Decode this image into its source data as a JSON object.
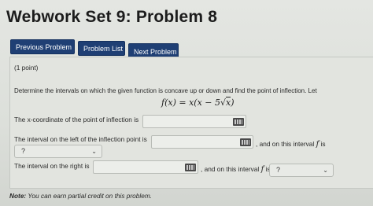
{
  "header": {
    "title": "Webwork Set 9: Problem 8"
  },
  "nav": {
    "previous_label": "Previous Problem",
    "list_label": "Problem List",
    "next_label": "Next Problem"
  },
  "problem": {
    "points": "(1 point)",
    "prompt": "Determine the intervals on which the given function is concave up or down and find the point of inflection. Let",
    "formula": {
      "lhs": "f(x) = x(x − 5",
      "radicand": "x",
      "close": ")"
    },
    "q1_label": "The x-coordinate of the point of inflection is",
    "q2_label": "The interval on the left of the inflection point is",
    "q2_suffix_before": ", and on this interval",
    "q2_suffix_var": "f",
    "q2_suffix_after": "is",
    "q2_select_value": "?",
    "q3_label": "The interval on the right is",
    "q3_suffix_before": ", and on this interval",
    "q3_suffix_var": "f",
    "q3_suffix_after": "is",
    "q3_select_value": "?"
  },
  "footer": {
    "note_prefix": "Note:",
    "note_text": " You can earn partial credit on this problem."
  },
  "icons": {
    "answer_keyboard": "keyboard-icon",
    "select_chevron": "chevron-down-icon"
  },
  "colors": {
    "nav_button": "#1f3f74",
    "background": "#dcdfda"
  }
}
